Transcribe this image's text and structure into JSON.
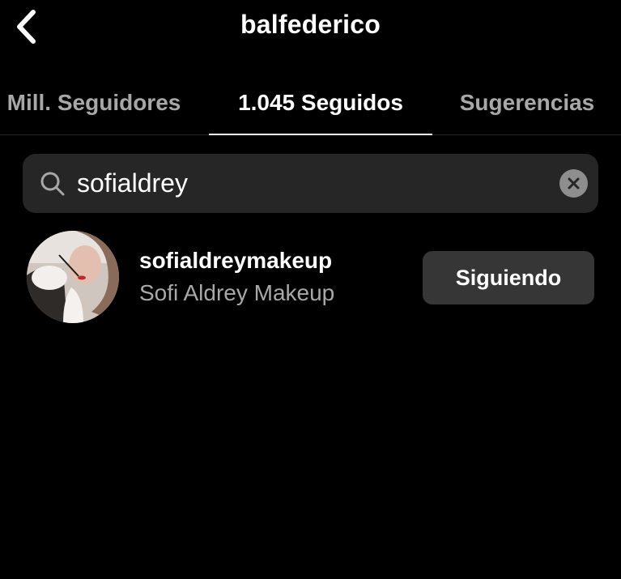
{
  "header": {
    "title": "balfederico",
    "back_icon": "chevron-left-icon"
  },
  "tabs": [
    {
      "label": "Mill. Seguidores",
      "active": false
    },
    {
      "label": "1.045 Seguidos",
      "active": true
    },
    {
      "label": "Sugerencias",
      "active": false
    }
  ],
  "search": {
    "value": "sofialdrey",
    "icon": "search-icon",
    "clear_icon": "clear-icon"
  },
  "results": [
    {
      "username": "sofialdreymakeup",
      "full_name": "Sofi Aldrey Makeup",
      "button_label": "Siguiendo"
    }
  ],
  "colors": {
    "background": "#000000",
    "primary_text": "#ffffff",
    "secondary_text": "#a8a8a8",
    "search_background": "#262626",
    "button_background": "#363636"
  }
}
